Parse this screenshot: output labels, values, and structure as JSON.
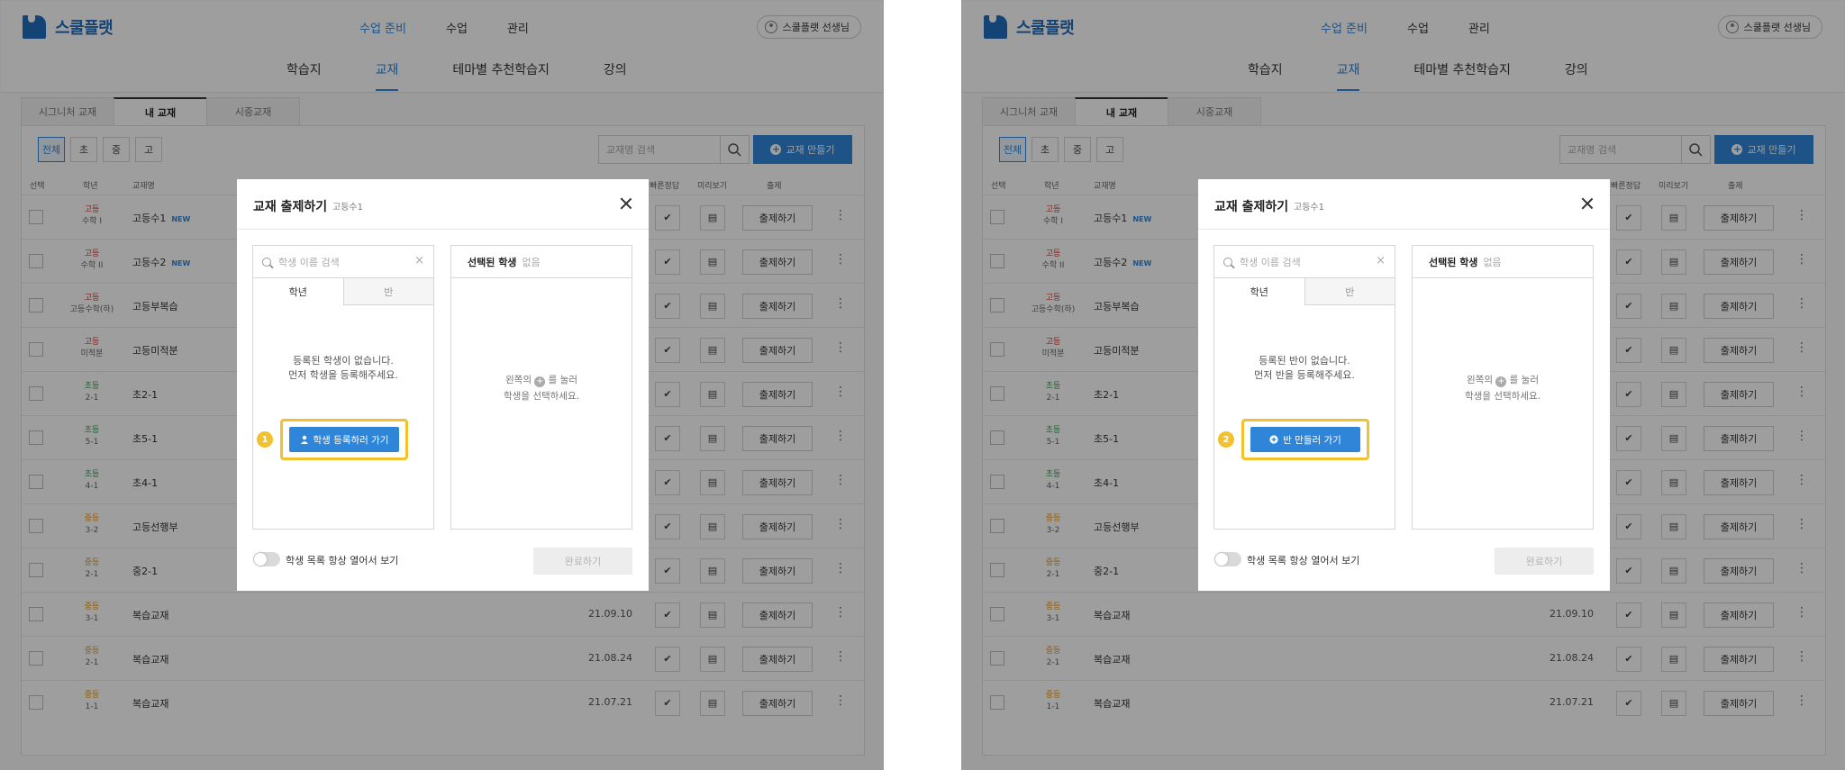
{
  "header": {
    "logo_text": "스쿨플랫",
    "gnb": [
      "수업 준비",
      "수업",
      "관리"
    ],
    "user_label": "스쿨플랫 선생님"
  },
  "subnav": [
    "학습지",
    "교재",
    "테마별 추천학습지",
    "강의"
  ],
  "tabs": [
    "시그니처 교재",
    "내 교재",
    "시중교재"
  ],
  "filters": [
    "전체",
    "초",
    "중",
    "고"
  ],
  "search_placeholder": "교재명 검색",
  "make_button": "교재 만들기",
  "columns": [
    "선택",
    "학년",
    "교재명",
    "빠른정답",
    "미리보기",
    "출제"
  ],
  "new_badge": "NEW",
  "assign_label": "출제하기",
  "rows": [
    {
      "lvl": "고등",
      "sub": "수학 I",
      "name": "고등수1",
      "new": true,
      "date": "",
      "cls": "lvl-high"
    },
    {
      "lvl": "고등",
      "sub": "수학 II",
      "name": "고등수2",
      "new": true,
      "date": "",
      "cls": "lvl-high"
    },
    {
      "lvl": "고등",
      "sub": "고등수학(하)",
      "name": "고등부복습",
      "new": false,
      "date": "",
      "cls": "lvl-high"
    },
    {
      "lvl": "고등",
      "sub": "미적분",
      "name": "고등미적분",
      "new": false,
      "date": "",
      "cls": "lvl-high"
    },
    {
      "lvl": "초등",
      "sub": "2-1",
      "name": "초2-1",
      "new": false,
      "date": "",
      "cls": "lvl-elem"
    },
    {
      "lvl": "초등",
      "sub": "5-1",
      "name": "초5-1",
      "new": false,
      "date": "",
      "cls": "lvl-elem"
    },
    {
      "lvl": "초등",
      "sub": "4-1",
      "name": "초4-1",
      "new": false,
      "date": "",
      "cls": "lvl-elem"
    },
    {
      "lvl": "중등",
      "sub": "3-2",
      "name": "고등선행부",
      "new": false,
      "date": "",
      "cls": "lvl-mid"
    },
    {
      "lvl": "중등",
      "sub": "2-1",
      "name": "중2-1",
      "new": false,
      "date": "",
      "cls": "lvl-mid"
    },
    {
      "lvl": "중등",
      "sub": "3-1",
      "name": "복습교재",
      "new": false,
      "date": "21.09.10",
      "cls": "lvl-mid"
    },
    {
      "lvl": "중등",
      "sub": "2-1",
      "name": "복습교재",
      "new": false,
      "date": "21.08.24",
      "cls": "lvl-mid"
    },
    {
      "lvl": "중등",
      "sub": "1-1",
      "name": "복습교재",
      "new": false,
      "date": "21.07.21",
      "cls": "lvl-mid"
    }
  ],
  "modal": {
    "title": "교재 출제하기",
    "subtitle": "고등수1",
    "student_search_placeholder": "학생 이름 검색",
    "segments": [
      "학년",
      "반"
    ],
    "selected_label": "선택된 학생",
    "selected_none": "없음",
    "right_msg_pre": "왼쪽의",
    "right_msg_post": "를 눌러",
    "right_msg_line2": "학생을 선택하세요.",
    "toggle_label": "학생 목록 항상 열어서 보기",
    "done_label": "완료하기"
  },
  "panels": {
    "left": {
      "empty_line1": "등록된 학생이 없습니다.",
      "empty_line2": "먼저 학생을 등록해주세요.",
      "action_label": "학생 등록하러 가기",
      "marker": "1"
    },
    "right": {
      "empty_line1": "등록된 반이 없습니다.",
      "empty_line2": "먼저 반을 등록해주세요.",
      "action_label": "반 만들러 가기",
      "marker": "2"
    }
  },
  "colors": {
    "accent": "#2f86d8",
    "logo": "#1f6fbd",
    "highlight": "#f2c12e"
  }
}
